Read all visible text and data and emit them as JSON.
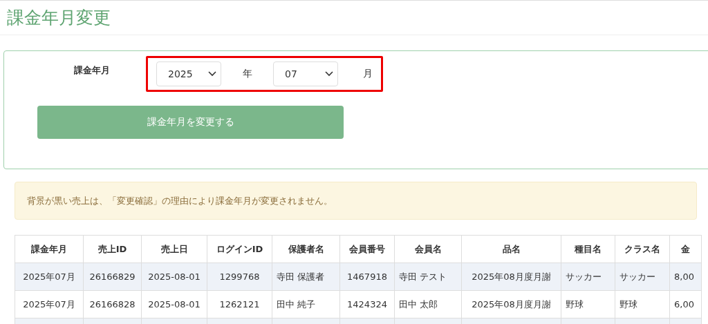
{
  "page_title": "課金年月変更",
  "form": {
    "label": "課金年月",
    "year": {
      "value": "2025",
      "unit": "年"
    },
    "month": {
      "value": "07",
      "unit": "月"
    },
    "submit": "課金年月を変更する"
  },
  "notice": "背景が黒い売上は、「変更確認」の理由により課金年月が変更されません。",
  "table": {
    "columns": [
      "課金年月",
      "売上ID",
      "売上日",
      "ログインID",
      "保護者名",
      "会員番号",
      "会員名",
      "品名",
      "種目名",
      "クラス名",
      "金"
    ],
    "rows": [
      [
        "2025年07月",
        "26166829",
        "2025-08-01",
        "1299768",
        "寺田 保護者",
        "1467918",
        "寺田 テスト",
        "2025年08月度月謝",
        "サッカー",
        "サッカー",
        "8,00"
      ],
      [
        "2025年07月",
        "26166828",
        "2025-08-01",
        "1262121",
        "田中 純子",
        "1424324",
        "田中 太郎",
        "2025年08月度月謝",
        "野球",
        "野球",
        "6,00"
      ]
    ]
  }
}
